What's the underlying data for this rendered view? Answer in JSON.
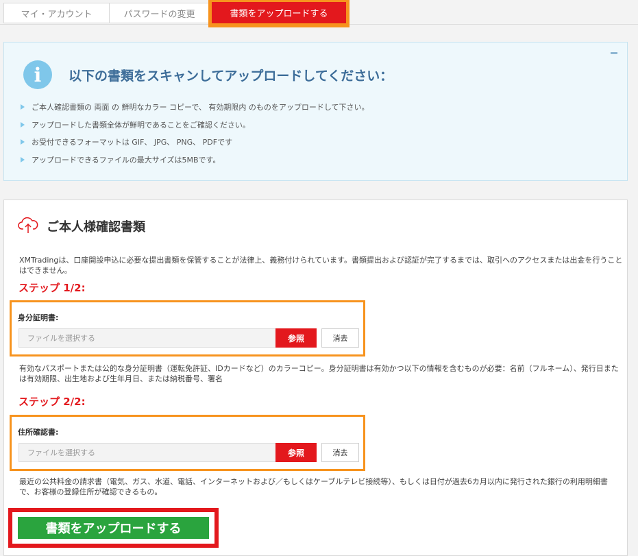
{
  "tabs": [
    {
      "label": "マイ・アカウント"
    },
    {
      "label": "パスワードの変更"
    },
    {
      "label": "書類をアップロードする"
    }
  ],
  "info": {
    "title": "以下の書類をスキャンしてアップロードしてください：",
    "bullets": [
      "ご本人確認書類の 両面 の 鮮明なカラー コピーで、 有効期限内 のものをアップロードして下さい。",
      "アップロードした書類全体が鮮明であることをご確認ください。",
      "お受付できるフォーマットは GIF、 JPG、 PNG、 PDFです",
      "アップロードできるファイルの最大サイズは5MBです。"
    ]
  },
  "documents": {
    "title": "ご本人様確認書類",
    "description": "XMTradingは、口座開設申込に必要な提出書類を保管することが法律上、義務付けられています。書類提出および認証が完了するまでは、取引へのアクセスまたは出金を行うことはできません。",
    "step1": {
      "heading": "ステップ 1/2:",
      "label": "身分証明書:",
      "placeholder": "ファイルを選択する",
      "browse_label": "参照",
      "clear_label": "消去",
      "note": "有効なパスポートまたは公的な身分証明書（運転免許証、IDカードなど）のカラーコピー。身分証明書は有効かつ以下の情報を含むものが必要：名前（フルネーム）、発行日または有効期限、出生地および生年月日、または納税番号、署名"
    },
    "step2": {
      "heading": "ステップ 2/2:",
      "label": "住所確認書:",
      "placeholder": "ファイルを選択する",
      "browse_label": "参照",
      "clear_label": "消去",
      "note": "最近の公共料金の請求書（電気、ガス、水道、電話、インターネットおよび／もしくはケーブルテレビ接続等）、もしくは日付が過去6カ月以内に発行された銀行の利用明細書で、お客様の登録住所が確認できるもの。"
    },
    "upload_label": "書類をアップロードする"
  },
  "colors": {
    "accent_red": "#e3181d",
    "highlight_orange": "#f7931e",
    "upload_green": "#2aa43e",
    "info_blue": "#3d6d99"
  },
  "icons": [
    "info-icon",
    "cloud-upload-icon",
    "bullet-arrow-icon"
  ]
}
